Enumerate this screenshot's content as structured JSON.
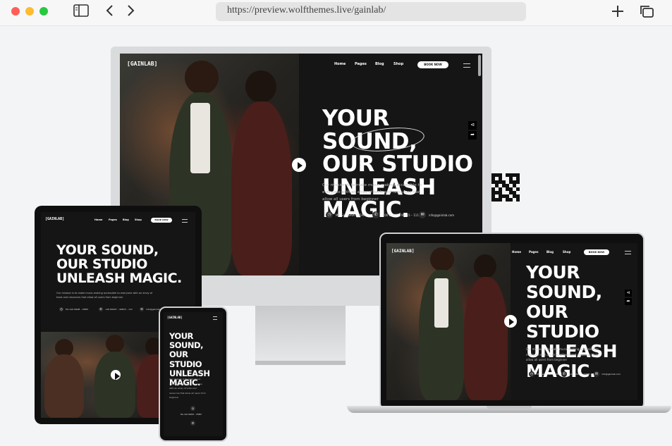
{
  "browser": {
    "url": "https://preview.wolfthemes.live/gainlab/",
    "traffic_colors": [
      "#ff5f57",
      "#febc2e",
      "#28c840"
    ],
    "icons": [
      "sidebar-icon",
      "back-icon",
      "forward-icon",
      "new-tab-icon",
      "tabs-overview-icon"
    ]
  },
  "site": {
    "logo": "[GAINLAB]",
    "nav": [
      "Home",
      "Pages",
      "Blog",
      "Shop"
    ],
    "cta": "BOOK NOW",
    "hero": {
      "line1": "YOUR SOUND,",
      "line2": "OUR STUDIO",
      "line3": "UNLEASH MAGIC.",
      "laptop_line3": "UNLEASH",
      "laptop_line4": "MAGIC.",
      "desc": "Our mission is to make music-making accessible to everyone with an array of tools and resources that allow all users from beginner"
    },
    "contacts": {
      "hours": "Mo–Sat 09AM – 05PM",
      "phone": "+00 80007 – 99815 – 111",
      "email": "info@gainlab.com"
    }
  }
}
